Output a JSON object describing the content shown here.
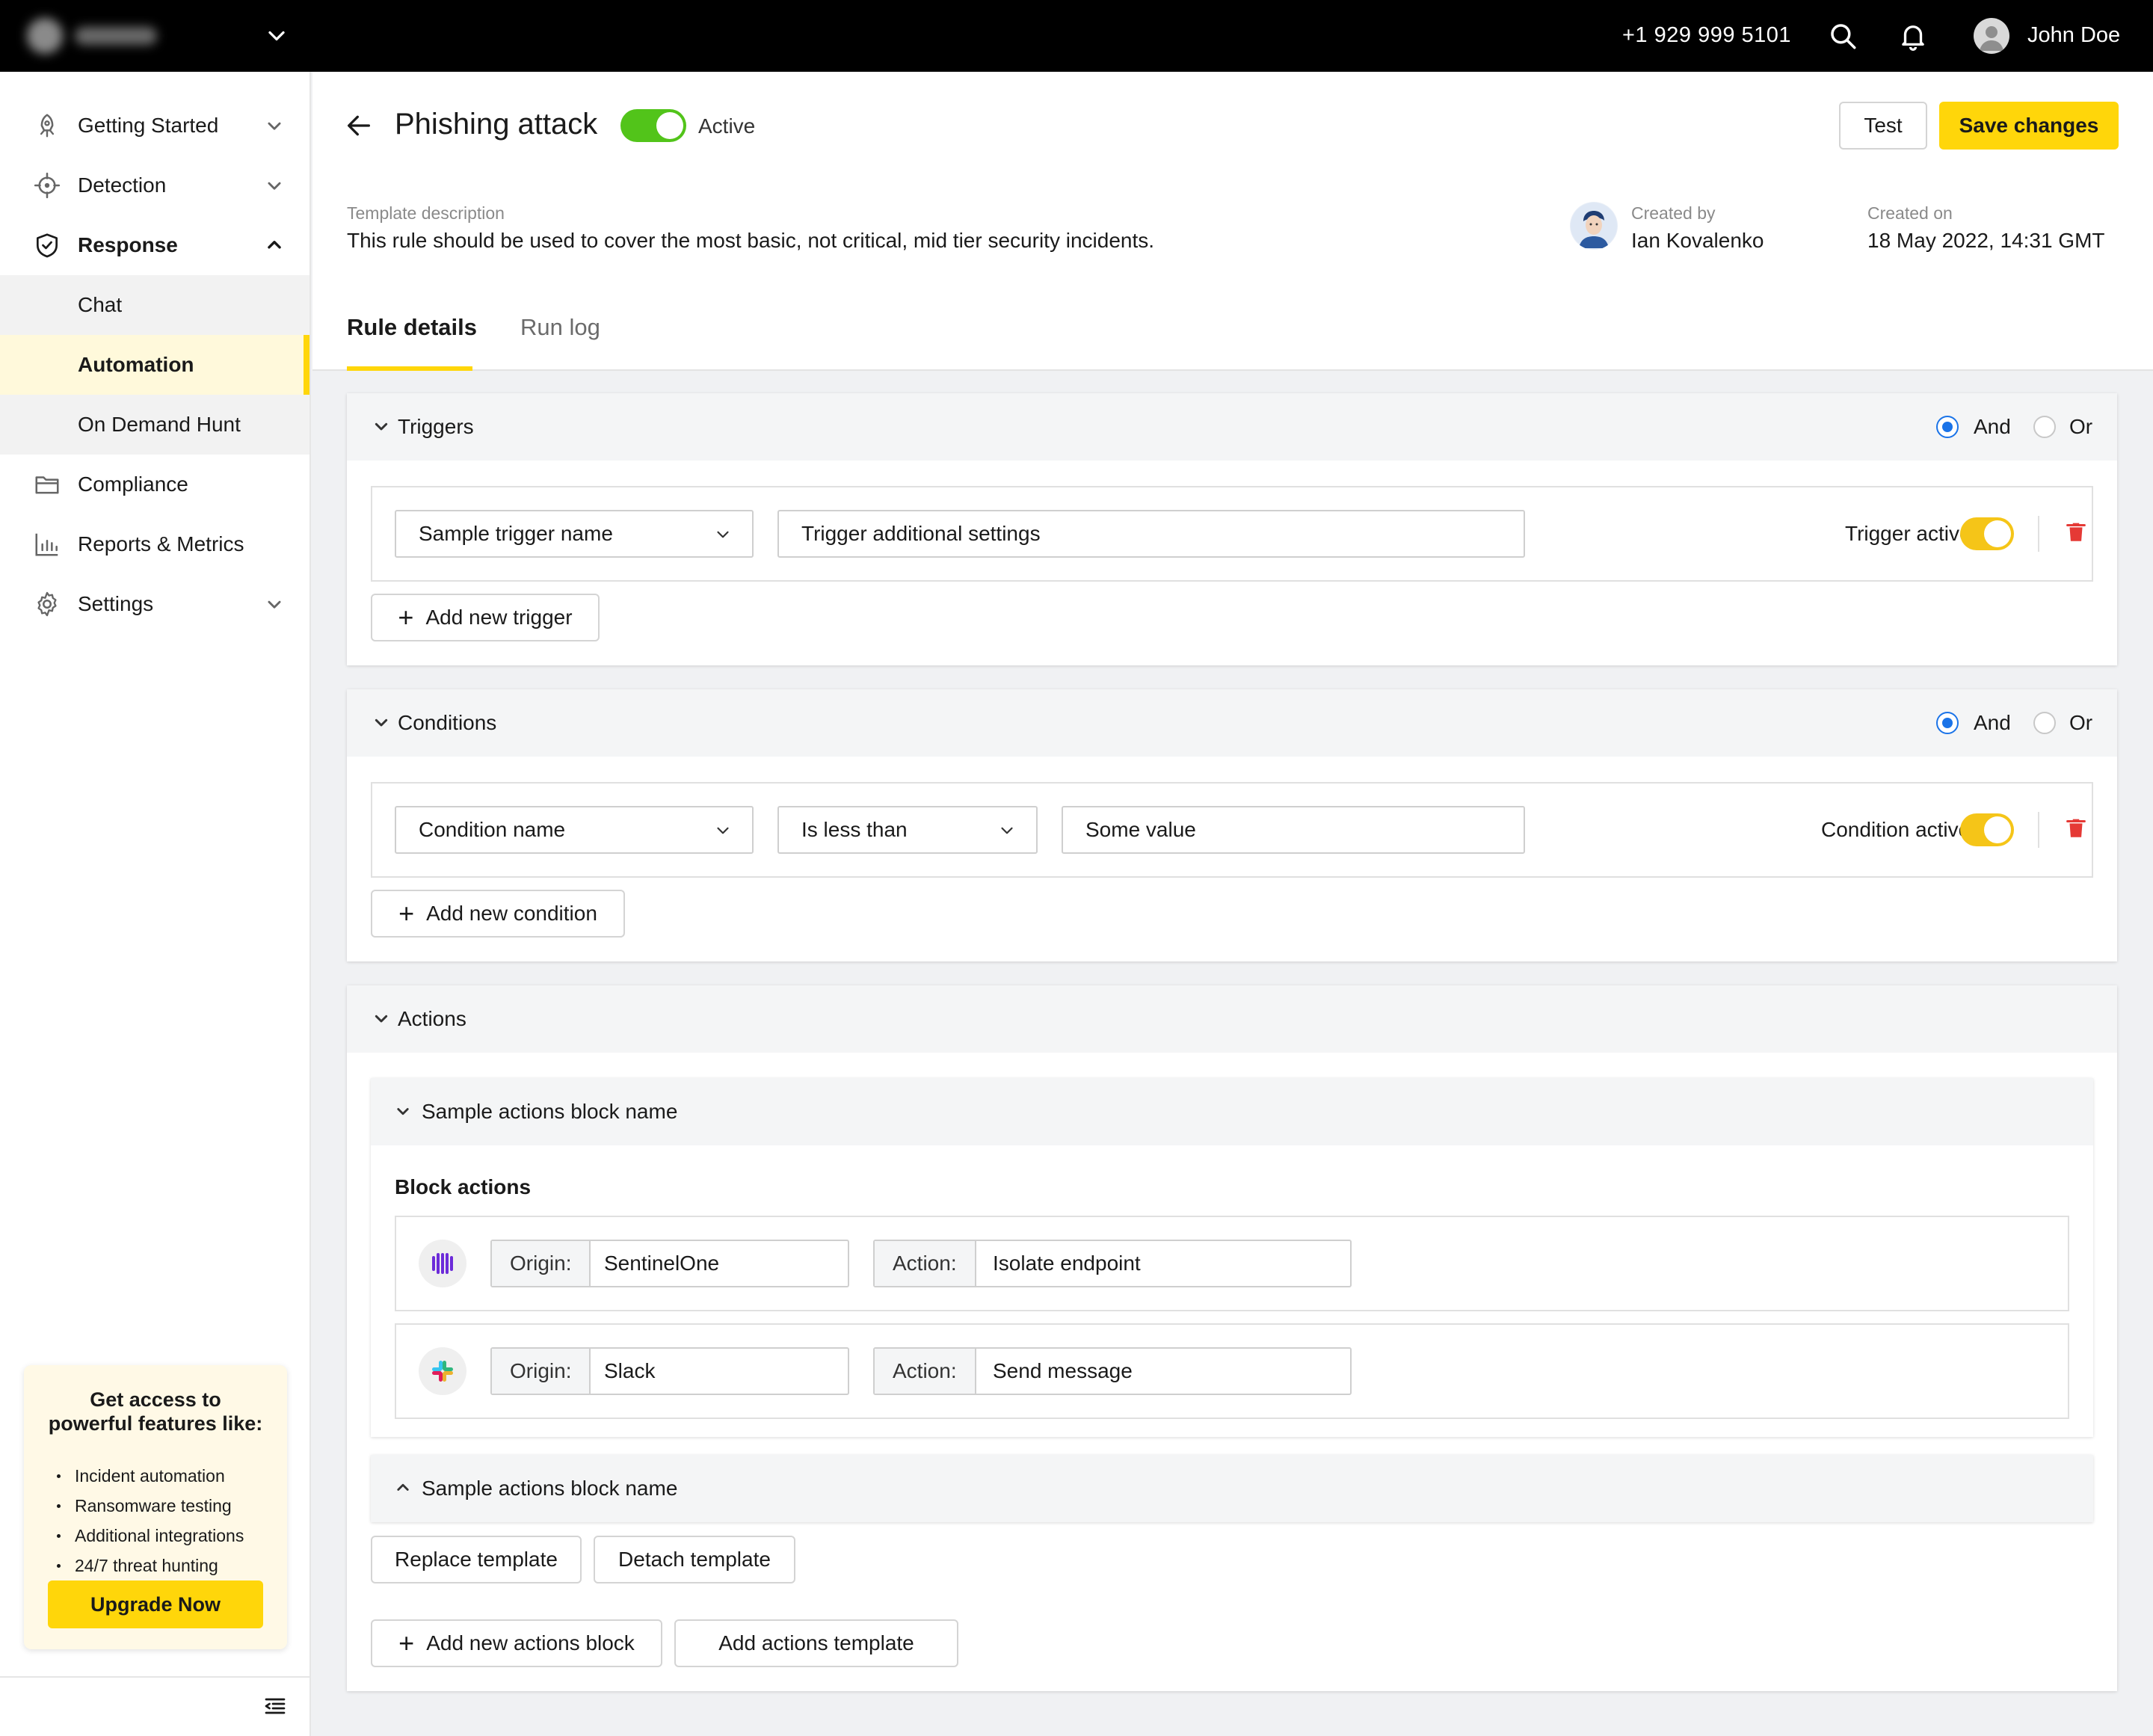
{
  "topbar": {
    "phone": "+1 929 999 5101",
    "user_name": "John Doe",
    "icons": [
      "chevron-down-icon",
      "search-icon",
      "bell-icon",
      "user-avatar-icon"
    ]
  },
  "sidebar": {
    "items": [
      {
        "label": "Getting Started",
        "icon": "rocket-icon"
      },
      {
        "label": "Detection",
        "icon": "crosshair-icon"
      },
      {
        "label": "Response",
        "icon": "shield-icon"
      },
      {
        "label": "Compliance",
        "icon": "folder-icon"
      },
      {
        "label": "Reports & Metrics",
        "icon": "bar-chart-icon"
      },
      {
        "label": "Settings",
        "icon": "gear-icon"
      }
    ],
    "subitems": [
      {
        "label": "Chat"
      },
      {
        "label": "Automation"
      },
      {
        "label": "On Demand Hunt"
      }
    ],
    "promo": {
      "title_line1": "Get access to",
      "title_line2": "powerful features like:",
      "features": [
        "Incident automation",
        "Ransomware testing",
        "Additional integrations",
        "24/7 threat hunting"
      ],
      "button": "Upgrade Now"
    }
  },
  "header": {
    "title": "Phishing attack",
    "status": "Active",
    "status_on": true,
    "test_button": "Test",
    "save_button": "Save changes",
    "description_label": "Template description",
    "description": "This rule should be used to cover the most basic, not critical, mid tier security incidents.",
    "created_by_label": "Created by",
    "created_by": "Ian Kovalenko",
    "created_on_label": "Created on",
    "created_on": "18 May 2022, 14:31 GMT"
  },
  "tabs": [
    {
      "label": "Rule details",
      "active": true
    },
    {
      "label": "Run log",
      "active": false
    }
  ],
  "triggers": {
    "title": "Triggers",
    "and_label": "And",
    "or_label": "Or",
    "selected": "And",
    "row": {
      "name": "Sample trigger name",
      "settings": "Trigger additional settings",
      "active_label": "Trigger active",
      "active": true
    },
    "add_button": "Add new trigger"
  },
  "conditions": {
    "title": "Conditions",
    "and_label": "And",
    "or_label": "Or",
    "selected": "And",
    "row": {
      "name": "Condition name",
      "operator": "Is less than",
      "value": "Some value",
      "active_label": "Condition active",
      "active": true
    },
    "add_button": "Add new condition"
  },
  "actions": {
    "title": "Actions",
    "blocks": [
      {
        "name": "Sample actions block name",
        "expanded": true,
        "block_actions_label": "Block actions",
        "rows": [
          {
            "icon": "sentinelone-icon",
            "origin_label": "Origin:",
            "origin": "SentinelOne",
            "action_label": "Action:",
            "action": "Isolate endpoint"
          },
          {
            "icon": "slack-icon",
            "origin_label": "Origin:",
            "origin": "Slack",
            "action_label": "Action:",
            "action": "Send message"
          }
        ]
      },
      {
        "name": "Sample actions block name",
        "expanded": false
      }
    ],
    "replace_template": "Replace template",
    "detach_template": "Detach template",
    "add_block": "Add new actions block",
    "add_template": "Add actions template"
  },
  "colors": {
    "accent": "#ffd60a",
    "toggle_green": "#52c41a",
    "radio_blue": "#1a73e8",
    "delete_red": "#e53935"
  }
}
